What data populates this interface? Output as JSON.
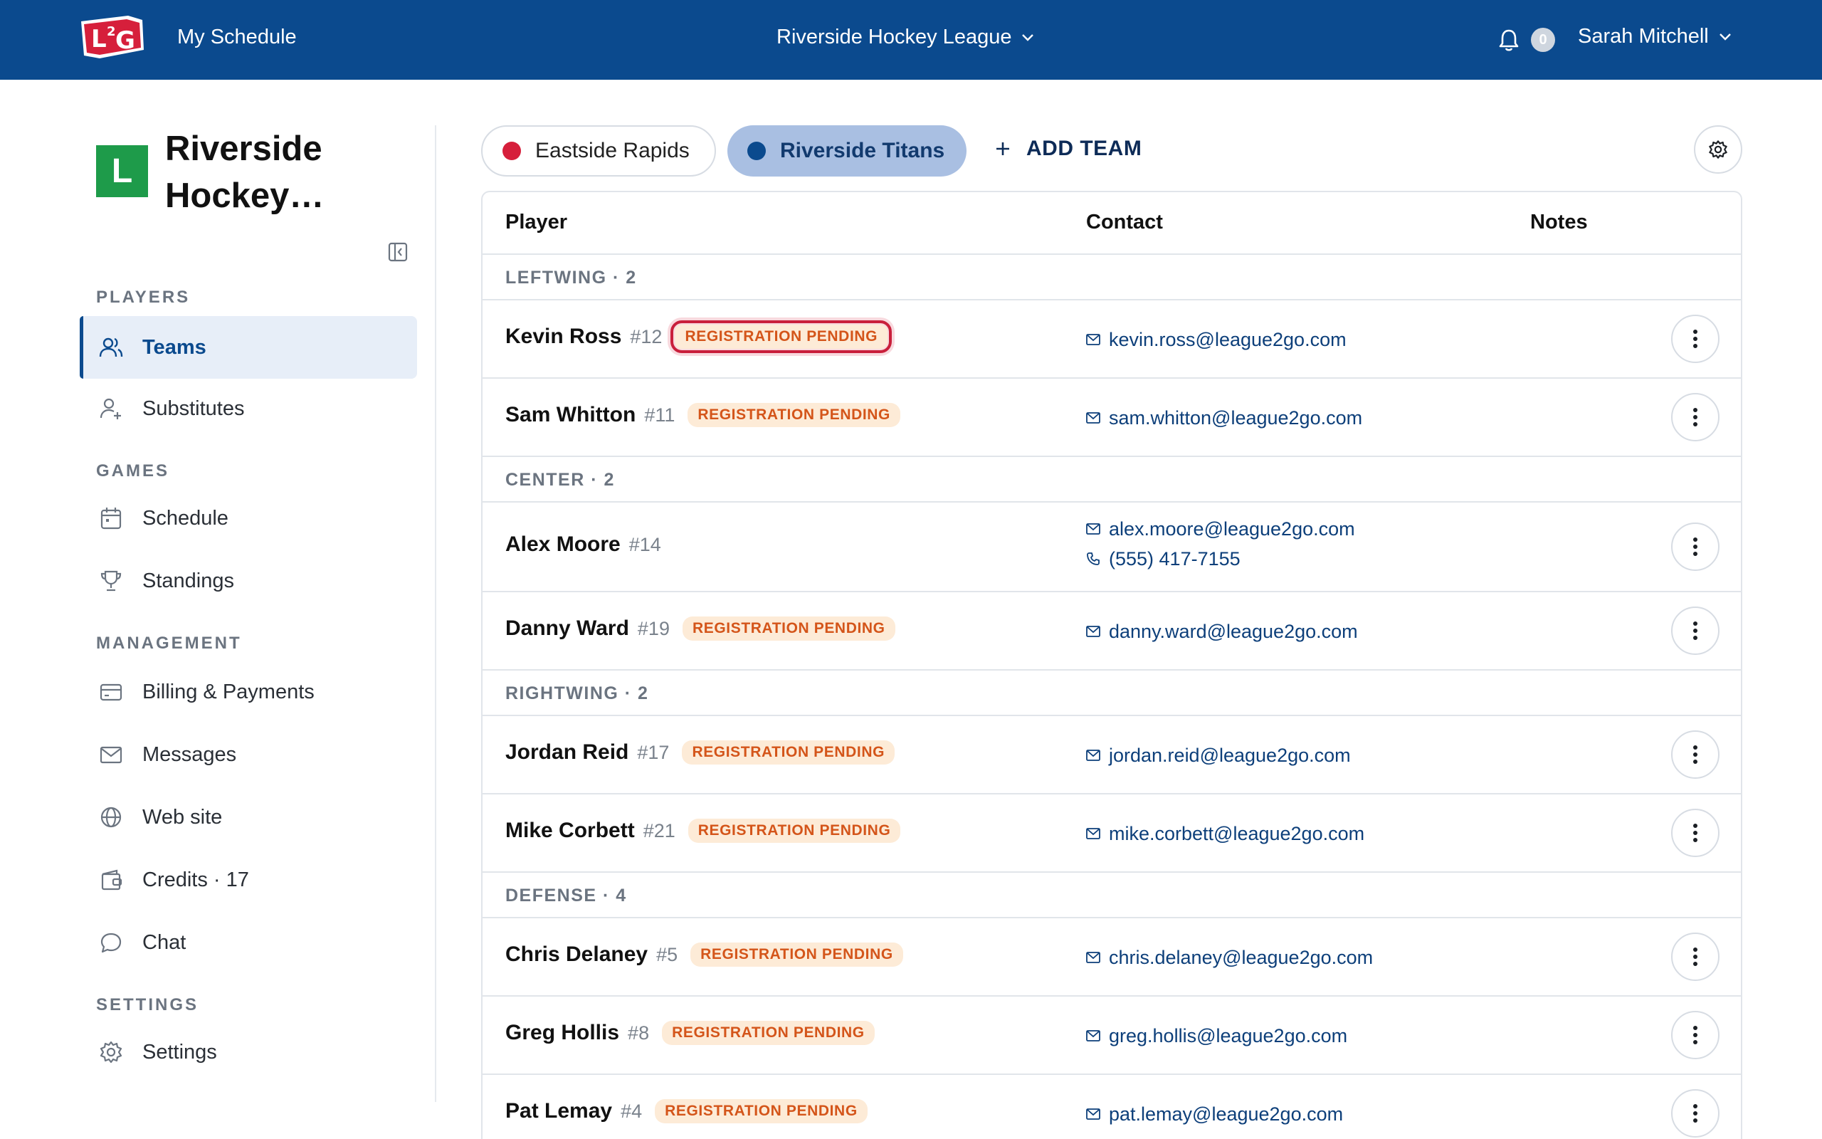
{
  "topbar": {
    "logo_text": "L2G",
    "my_schedule": "My Schedule",
    "league": "Riverside Hockey League",
    "notifications_count": "0",
    "user": "Sarah Mitchell"
  },
  "sidebar": {
    "org_initial": "L",
    "org_name": "Riverside Hockey…",
    "sections": {
      "players": "PLAYERS",
      "games": "GAMES",
      "management": "MANAGEMENT",
      "settings": "SETTINGS"
    },
    "items": {
      "teams": "Teams",
      "substitutes": "Substitutes",
      "schedule": "Schedule",
      "standings": "Standings",
      "billing": "Billing & Payments",
      "messages": "Messages",
      "website": "Web site",
      "credits": "Credits · 17",
      "chat": "Chat",
      "settings": "Settings"
    }
  },
  "teams": {
    "tab1": {
      "name": "Eastside Rapids",
      "color": "#d61f3b"
    },
    "tab2": {
      "name": "Riverside Titans",
      "color": "#0b4a8e"
    },
    "add": "ADD TEAM"
  },
  "table": {
    "headers": {
      "player": "Player",
      "contact": "Contact",
      "notes": "Notes"
    },
    "groups": {
      "leftwing": "LEFTWING · 2",
      "center": "CENTER · 2",
      "rightwing": "RIGHTWING · 2",
      "defense": "DEFENSE · 4"
    },
    "badge": "REGISTRATION PENDING",
    "players": [
      {
        "name": "Kevin Ross",
        "number": "#12",
        "email": "kevin.ross@league2go.com"
      },
      {
        "name": "Sam Whitton",
        "number": "#11",
        "email": "sam.whitton@league2go.com"
      },
      {
        "name": "Alex Moore",
        "number": "#14",
        "email": "alex.moore@league2go.com",
        "phone": "(555) 417-7155"
      },
      {
        "name": "Danny Ward",
        "number": "#19",
        "email": "danny.ward@league2go.com"
      },
      {
        "name": "Jordan Reid",
        "number": "#17",
        "email": "jordan.reid@league2go.com"
      },
      {
        "name": "Mike Corbett",
        "number": "#21",
        "email": "mike.corbett@league2go.com"
      },
      {
        "name": "Chris Delaney",
        "number": "#5",
        "email": "chris.delaney@league2go.com"
      },
      {
        "name": "Greg Hollis",
        "number": "#8",
        "email": "greg.hollis@league2go.com"
      },
      {
        "name": "Pat Lemay",
        "number": "#4",
        "email": "pat.lemay@league2go.com"
      }
    ]
  },
  "colors": {
    "brand": "#0b4a8e",
    "badge_text": "#d4551a",
    "badge_bg": "#fdebd7",
    "focus": "#c91f3b"
  }
}
